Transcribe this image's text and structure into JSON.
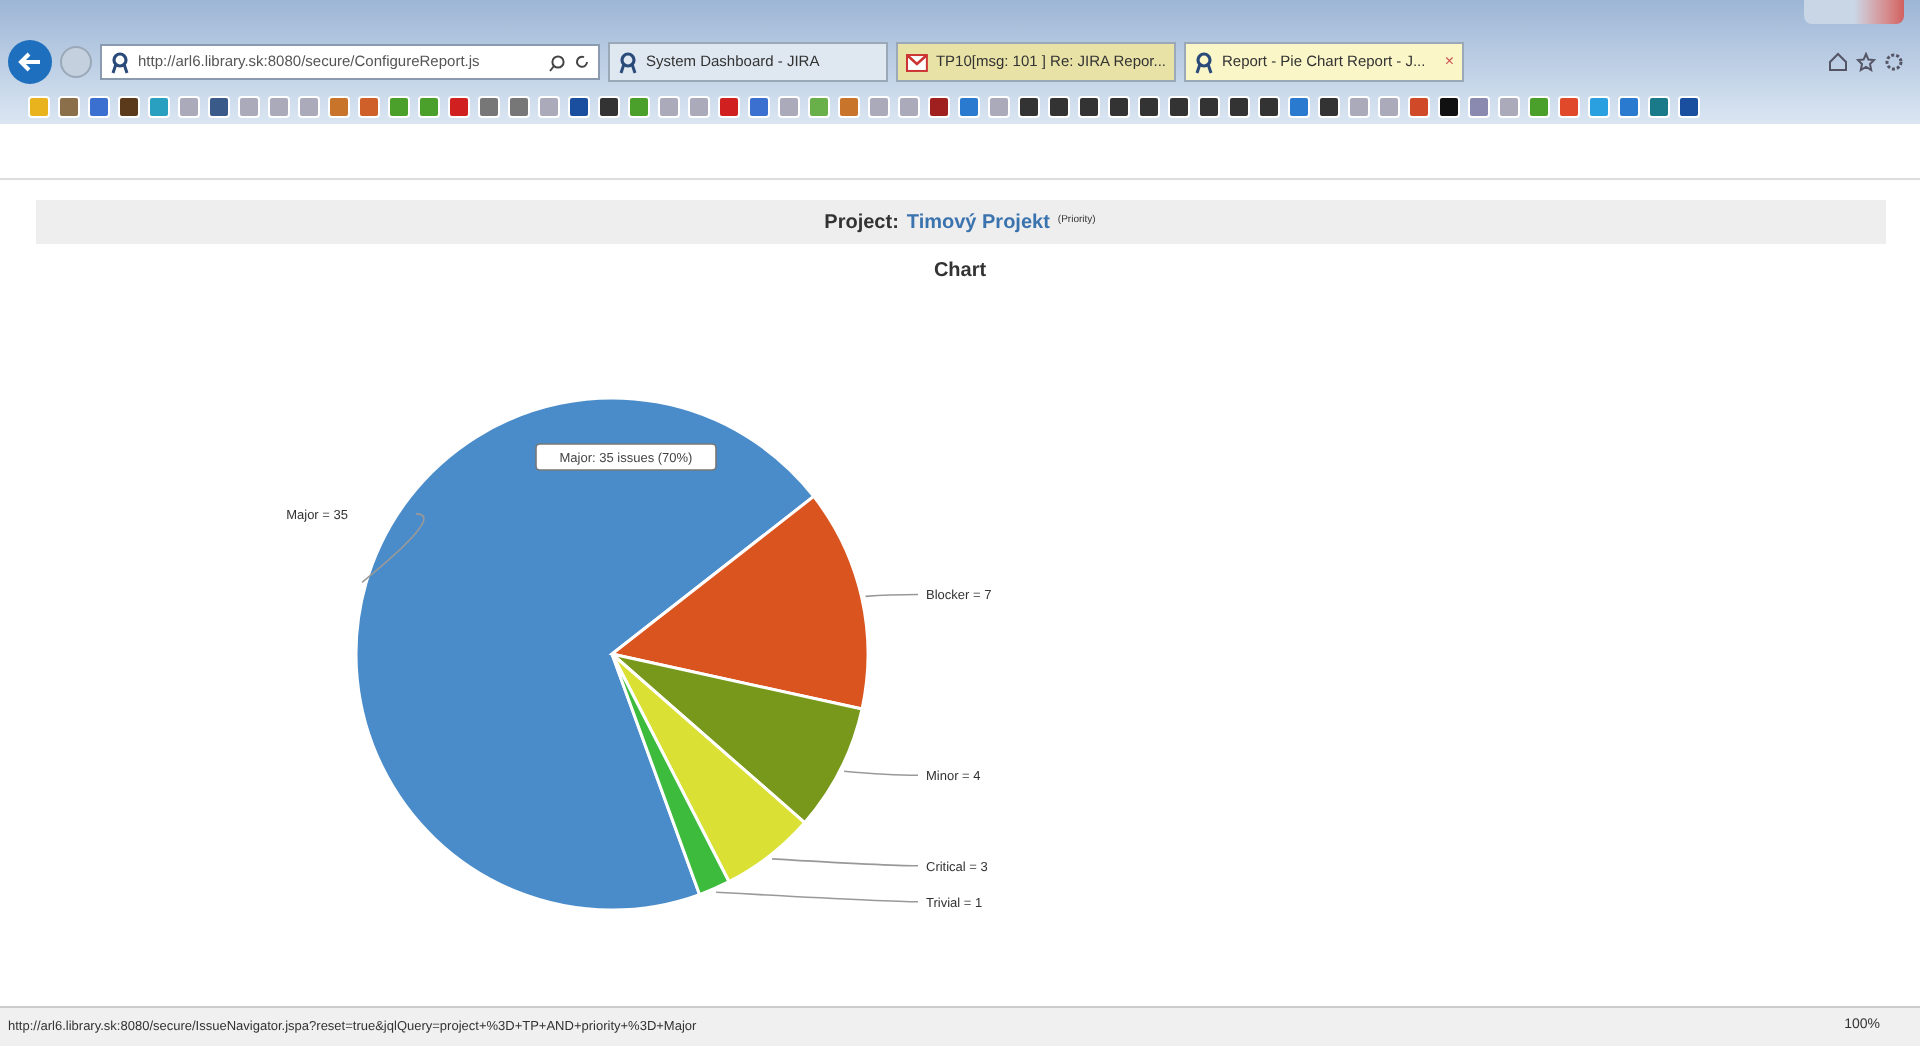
{
  "address_bar": {
    "url": "http://arl6.library.sk:8080/secure/ConfigureReport.js"
  },
  "tabs": [
    {
      "title": "System Dashboard - JIRA",
      "selected": false,
      "kind": "jira"
    },
    {
      "title": "TP10[msg: 101 ] Re: JIRA Repor...",
      "selected": false,
      "kind": "mail"
    },
    {
      "title": "Report - Pie Chart Report - J...",
      "selected": true,
      "kind": "jira",
      "close": "×"
    }
  ],
  "report": {
    "label": "Project:",
    "project": "Timový Projekt",
    "group_by": "(Priority)",
    "title": "Chart",
    "chart_data": {
      "type": "pie",
      "values": [
        7,
        4,
        3,
        1,
        35
      ],
      "colors": [
        "#d9541e",
        "#77981a",
        "#dbe035",
        "#3dbb3d",
        "#4a8cc9"
      ],
      "value_labels": [
        "Blocker = 7",
        "Minor = 4",
        "Critical = 3",
        "Trivial = 1",
        "Major = 35"
      ],
      "annotations": [
        "Major: 35 issues (70%)"
      ]
    }
  },
  "status_bar": {
    "url": "http://arl6.library.sk:8080/secure/IssueNavigator.jspa?reset=true&jqlQuery=project+%3D+TP+AND+priority+%3D+Major",
    "zoom": "100%"
  }
}
